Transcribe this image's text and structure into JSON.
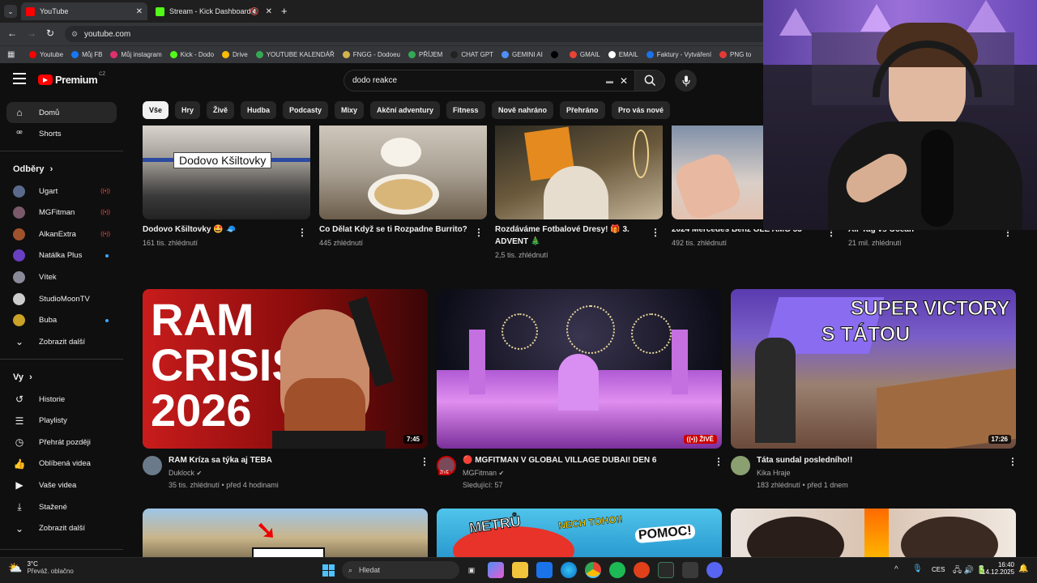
{
  "browser": {
    "tabs": [
      {
        "label": "YouTube",
        "color": "#ff0000"
      },
      {
        "label": "Stream - Kick Dashboard",
        "color": "#53fc18"
      }
    ],
    "url": "youtube.com",
    "bookmarks": [
      {
        "label": "Youtube",
        "color": "#ff0000"
      },
      {
        "label": "Můj FB",
        "color": "#1877f2"
      },
      {
        "label": "Můj instagram",
        "color": "#e1306c"
      },
      {
        "label": "Kick - Dodo",
        "color": "#53fc18"
      },
      {
        "label": "Drive",
        "color": "#fbbc04"
      },
      {
        "label": "YOUTUBE KALENDÁŘ",
        "color": "#34a853"
      },
      {
        "label": "FNGG - Dodoeu",
        "color": "#d4b24c"
      },
      {
        "label": "PŘÍJEM",
        "color": "#34a853"
      },
      {
        "label": "CHAT GPT",
        "color": "#222222"
      },
      {
        "label": "GEMINI AI",
        "color": "#4f8ff7"
      },
      {
        "label": "",
        "color": "#000000"
      },
      {
        "label": "GMAIL",
        "color": "#ea4335"
      },
      {
        "label": "EMAIL",
        "color": "#ffffff"
      },
      {
        "label": "Faktury - Vytváření",
        "color": "#1a73e8"
      },
      {
        "label": "PNG to",
        "color": "#e53935"
      }
    ]
  },
  "yt": {
    "logo": "Premium",
    "region": "CZ",
    "search_value": "dodo reakce",
    "sidebar": {
      "home": "Domů",
      "shorts": "Shorts",
      "subs_header": "Odběry",
      "channels": [
        {
          "name": "Ugart",
          "status": "live",
          "color": "#5a6a8a"
        },
        {
          "name": "MGFitman",
          "status": "live",
          "color": "#7a5a6a"
        },
        {
          "name": "AlkanExtra",
          "status": "live",
          "color": "#a0522d"
        },
        {
          "name": "Natálka Plus",
          "status": "new",
          "color": "#6a3fc1"
        },
        {
          "name": "Vítek",
          "status": "",
          "color": "#8a8a9a"
        },
        {
          "name": "StudioMoonTV",
          "status": "",
          "color": "#cccccc"
        },
        {
          "name": "Buba",
          "status": "new",
          "color": "#c9a227"
        }
      ],
      "show_more": "Zobrazit další",
      "you_header": "Vy",
      "you_items": [
        "Historie",
        "Playlisty",
        "Přehrát později",
        "Oblíbená videa",
        "Vaše videa",
        "Stažené",
        "Zobrazit další"
      ]
    },
    "chips": [
      "Vše",
      "Hry",
      "Živě",
      "Hudba",
      "Podcasty",
      "Mixy",
      "Akční adventury",
      "Fitness",
      "Nově nahráno",
      "Přehráno",
      "Pro vás nové"
    ],
    "row1": [
      {
        "title": "Dodovo Kšiltovky 🤩 🧢",
        "meta": "161 tis. zhlédnutí",
        "overlay": "Dodovo Kšiltovky"
      },
      {
        "title": "Co Dělat Když se ti Rozpadne Burrito?",
        "meta": "445 zhlédnutí"
      },
      {
        "title": "Rozdáváme Fotbalové Dresy! 🎁 3.",
        "title2": "ADVENT 🎄",
        "meta": "2,5 tis. zhlédnutí"
      },
      {
        "title": "2024 Mercedes Benz GLE AMG 53",
        "meta": "492 tis. zhlédnutí"
      },
      {
        "title": "Air Tag vs Ocean",
        "meta": "21 mil. zhlédnutí"
      }
    ],
    "row2": [
      {
        "title": "RAM Kríza sa týka aj TEBA",
        "channel": "Duklock",
        "meta": "35 tis. zhlédnutí • před 4 hodinami",
        "duration": "7:45",
        "thumb_text": [
          "RAM",
          "CRISIS",
          "2026"
        ]
      },
      {
        "title": "🔴 MGFITMAN V GLOBAL VILLAGE DUBAI! DEN 6",
        "channel": "MGFitman",
        "meta": "Sledující: 57",
        "live_badge": "ŽIVĚ",
        "avatar_badge": "ŽIVĚ"
      },
      {
        "title": "Táta sundal posledního!!",
        "channel": "Kika Hraje",
        "meta": "183 zhlédnutí • před 1 dnem",
        "duration": "17:26",
        "thumb_text": [
          "SUPER VICTORY",
          "S TÁTOU"
        ]
      }
    ],
    "row3_text": [
      "METRŮ",
      "NECH TOHO!!",
      "POMOC!"
    ]
  },
  "taskbar": {
    "weather_temp": "3°C",
    "weather_desc": "Převáž. oblačno",
    "search_placeholder": "Hledat",
    "lang": "CES",
    "time": "16:40",
    "date": "14.12.2025"
  }
}
